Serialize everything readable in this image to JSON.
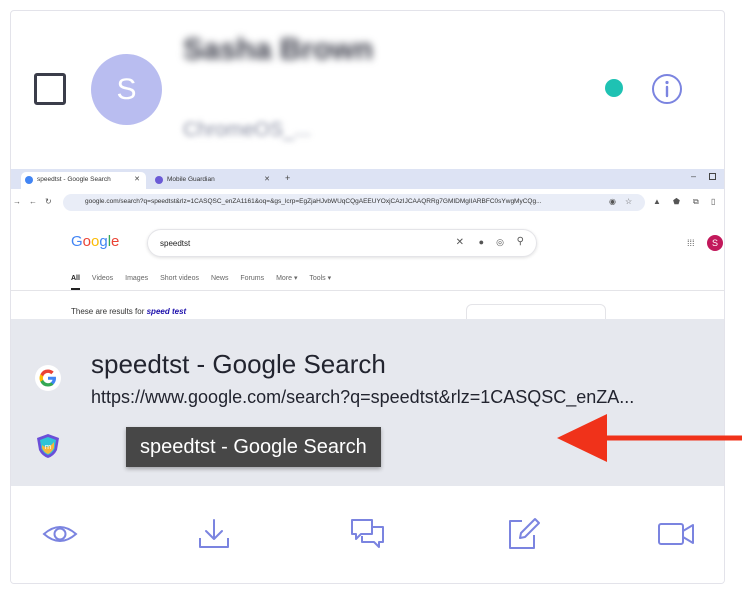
{
  "user": {
    "initial": "S",
    "name": "Sasha Brown",
    "device": "ChromeOS_..."
  },
  "status": {
    "online_color": "#1fc2b3"
  },
  "icons": {
    "checkbox": "checkbox-icon",
    "info": "info-icon",
    "google": "google-icon",
    "guardian": "mobile-guardian-icon",
    "view": "eye-icon",
    "download": "download-icon",
    "message": "chat-icon",
    "note": "note-edit-icon",
    "video": "video-icon",
    "arrow": "red-arrow-icon"
  },
  "browser": {
    "tabs": [
      {
        "label": "speedtst - Google Search"
      },
      {
        "label": "Mobile Guardian"
      }
    ],
    "url_bar": "google.com/search?q=speedtst&rlz=1CASQSC_enZA1161&oq=&gs_lcrp=EgZjaHJvbWUqCQgAEEUYOxjCAzIJCAAQRRg7GMIDMgIIARBFC0sYwgMyCQg...",
    "google_logo": "Google",
    "search_query": "speedtst",
    "result_tabs": [
      "All",
      "Videos",
      "Images",
      "Short videos",
      "News",
      "Forums",
      "More ▾",
      "Tools ▾"
    ],
    "results_note_prefix": "These are results for",
    "results_note_query": "speed test",
    "avatar_initial": "S"
  },
  "activity": {
    "title": "speedtst - Google Search",
    "url": "https://www.google.com/search?q=speedtst&rlz=1CASQSC_enZA...",
    "tooltip": "speedtst - Google Search"
  },
  "colors": {
    "accent": "#7b84e0",
    "avatar_bg": "#b9bdf0",
    "overlay_bg": "#e6e8ee",
    "arrow": "#f0321a"
  }
}
